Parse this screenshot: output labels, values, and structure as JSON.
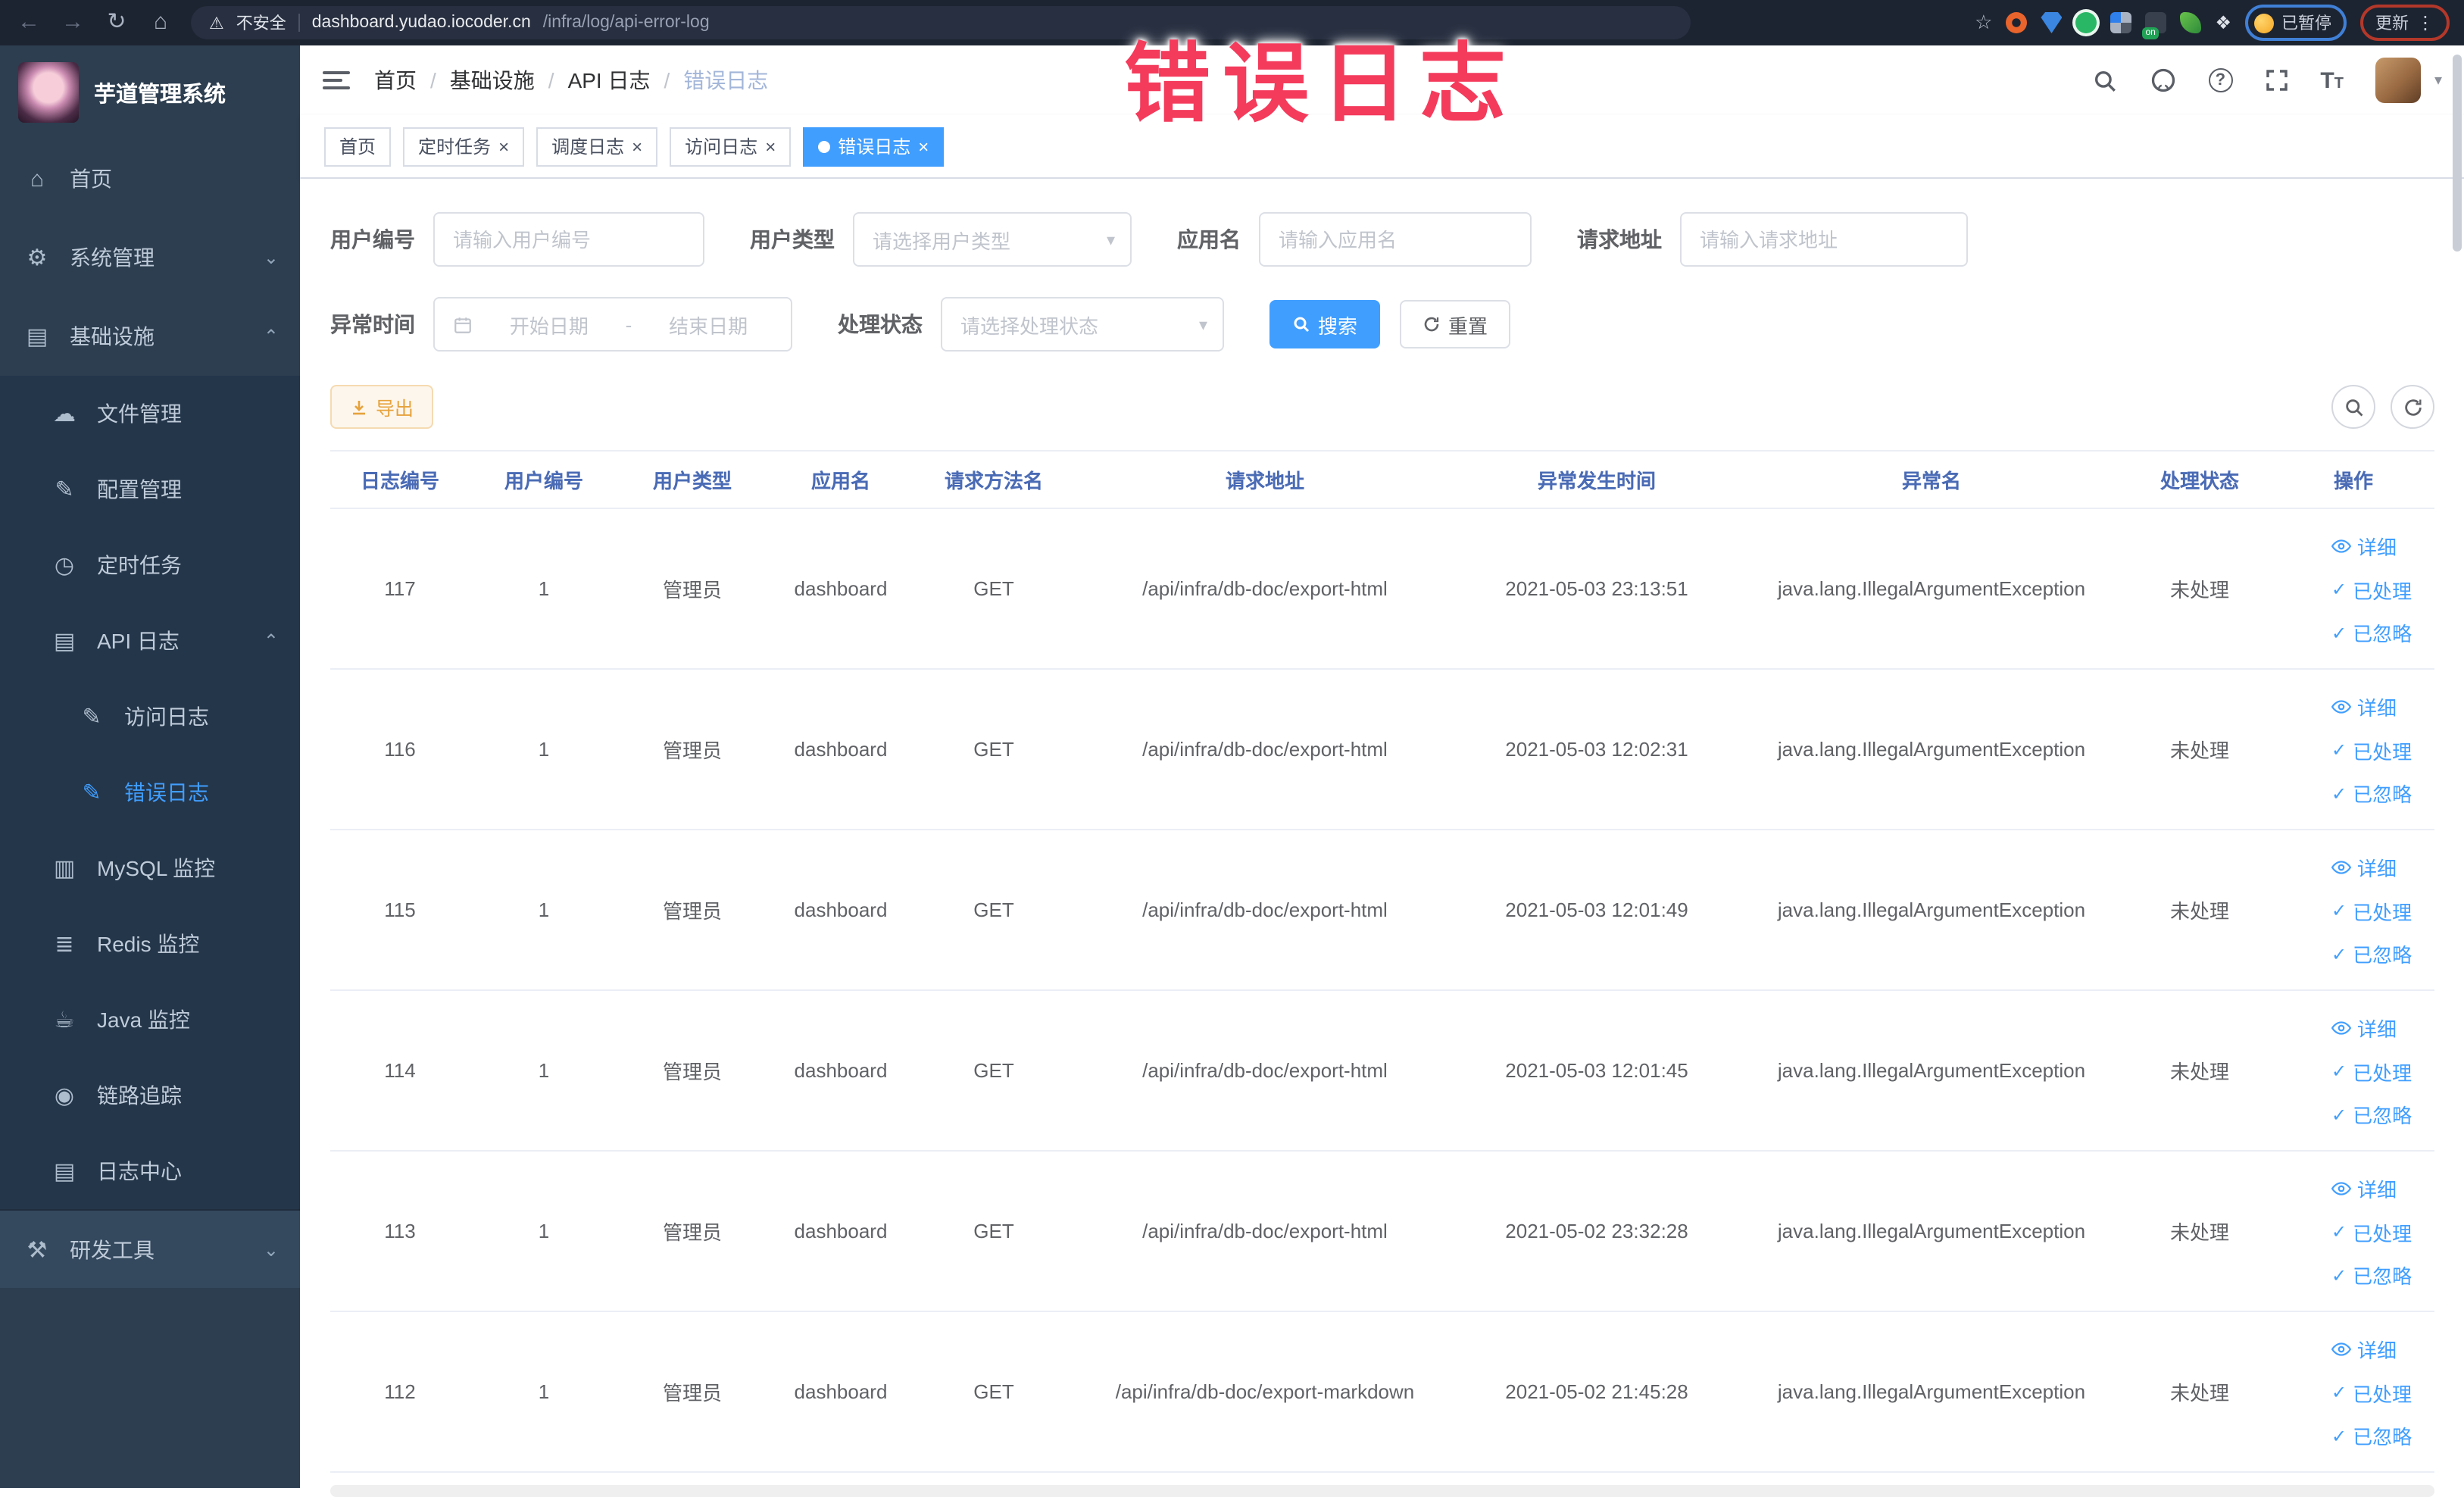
{
  "colors": {
    "accent": "#409eff",
    "sidebar_bg": "#2c3e50",
    "sidebar_submenu_bg": "#24364a",
    "sidebar_highlight_bg": "#34495e",
    "annotation_pink": "#f43b5c",
    "warning_orange": "#e6a23c",
    "table_header_blue": "#4a6bb5",
    "browser_bar_bg": "#1d2431"
  },
  "browser": {
    "security_label": "不安全",
    "url_domain": "dashboard.yudao.iocoder.cn",
    "url_path": "/infra/log/api-error-log",
    "paused_badge": "已暂停",
    "update_label": "更新",
    "ext_on_badge": "on"
  },
  "annotation": {
    "text": "错误日志"
  },
  "sidebar": {
    "logo_title": "芋道管理系统",
    "items": [
      {
        "key": "home",
        "label": "首页",
        "icon": "home",
        "level": 0
      },
      {
        "key": "system",
        "label": "系统管理",
        "icon": "gear",
        "level": 0,
        "chevron": "down"
      },
      {
        "key": "infra",
        "label": "基础设施",
        "icon": "monitor",
        "level": 0,
        "chevron": "up"
      },
      {
        "key": "file",
        "label": "文件管理",
        "icon": "cloud",
        "level": 1,
        "sub": true
      },
      {
        "key": "config",
        "label": "配置管理",
        "icon": "edit",
        "level": 1,
        "sub": true
      },
      {
        "key": "job",
        "label": "定时任务",
        "icon": "clock",
        "level": 1,
        "sub": true
      },
      {
        "key": "api-log",
        "label": "API 日志",
        "icon": "log",
        "level": 1,
        "sub": true,
        "chevron": "up"
      },
      {
        "key": "access-log",
        "label": "访问日志",
        "icon": "edit",
        "level": 2,
        "sub": true
      },
      {
        "key": "error-log",
        "label": "错误日志",
        "icon": "edit",
        "level": 2,
        "sub": true,
        "active": true
      },
      {
        "key": "mysql",
        "label": "MySQL 监控",
        "icon": "chart",
        "level": 1,
        "sub": true
      },
      {
        "key": "redis",
        "label": "Redis 监控",
        "icon": "stack",
        "level": 1,
        "sub": true
      },
      {
        "key": "java",
        "label": "Java 监控",
        "icon": "coffee",
        "level": 1,
        "sub": true
      },
      {
        "key": "trace",
        "label": "链路追踪",
        "icon": "eye",
        "level": 1,
        "sub": true
      },
      {
        "key": "log-center",
        "label": "日志中心",
        "icon": "doc",
        "level": 1,
        "sub": true
      },
      {
        "key": "dev-tools",
        "label": "研发工具",
        "icon": "toolbox",
        "level": 0,
        "chevron": "down",
        "highlight": true
      }
    ]
  },
  "header": {
    "breadcrumb": [
      "首页",
      "基础设施",
      "API 日志",
      "错误日志"
    ]
  },
  "tags": [
    {
      "label": "首页",
      "closable": false,
      "active": false
    },
    {
      "label": "定时任务",
      "closable": true,
      "active": false
    },
    {
      "label": "调度日志",
      "closable": true,
      "active": false
    },
    {
      "label": "访问日志",
      "closable": true,
      "active": false
    },
    {
      "label": "错误日志",
      "closable": true,
      "active": true
    }
  ],
  "filters": {
    "user_id_label": "用户编号",
    "user_id_placeholder": "请输入用户编号",
    "user_type_label": "用户类型",
    "user_type_placeholder": "请选择用户类型",
    "app_name_label": "应用名",
    "app_name_placeholder": "请输入应用名",
    "request_url_label": "请求地址",
    "request_url_placeholder": "请输入请求地址",
    "exception_time_label": "异常时间",
    "start_date_placeholder": "开始日期",
    "range_separator": "-",
    "end_date_placeholder": "结束日期",
    "process_status_label": "处理状态",
    "process_status_placeholder": "请选择处理状态",
    "search_button": "搜索",
    "reset_button": "重置"
  },
  "toolbar": {
    "export_label": "导出"
  },
  "table": {
    "headers": [
      "日志编号",
      "用户编号",
      "用户类型",
      "应用名",
      "请求方法名",
      "请求地址",
      "异常发生时间",
      "异常名",
      "处理状态",
      "操作"
    ],
    "rows": [
      [
        "117",
        "1",
        "管理员",
        "dashboard",
        "GET",
        "/api/infra/db-doc/export-html",
        "2021-05-03 23:13:51",
        "java.lang.IllegalArgumentException",
        "未处理"
      ],
      [
        "116",
        "1",
        "管理员",
        "dashboard",
        "GET",
        "/api/infra/db-doc/export-html",
        "2021-05-03 12:02:31",
        "java.lang.IllegalArgumentException",
        "未处理"
      ],
      [
        "115",
        "1",
        "管理员",
        "dashboard",
        "GET",
        "/api/infra/db-doc/export-html",
        "2021-05-03 12:01:49",
        "java.lang.IllegalArgumentException",
        "未处理"
      ],
      [
        "114",
        "1",
        "管理员",
        "dashboard",
        "GET",
        "/api/infra/db-doc/export-html",
        "2021-05-03 12:01:45",
        "java.lang.IllegalArgumentException",
        "未处理"
      ],
      [
        "113",
        "1",
        "管理员",
        "dashboard",
        "GET",
        "/api/infra/db-doc/export-html",
        "2021-05-02 23:32:28",
        "java.lang.IllegalArgumentException",
        "未处理"
      ],
      [
        "112",
        "1",
        "管理员",
        "dashboard",
        "GET",
        "/api/infra/db-doc/export-markdown",
        "2021-05-02 21:45:28",
        "java.lang.IllegalArgumentException",
        "未处理"
      ]
    ],
    "actions": [
      {
        "label": "详细",
        "icon": "eye"
      },
      {
        "label": "已处理",
        "icon": "check"
      },
      {
        "label": "已忽略",
        "icon": "check"
      }
    ]
  },
  "icons": {
    "home": "⌂",
    "gear": "⚙",
    "monitor": "▤",
    "cloud": "☁",
    "edit": "✎",
    "clock": "◷",
    "log": "▤",
    "chart": "▥",
    "stack": "≣",
    "coffee": "☕",
    "eye": "◉",
    "doc": "▤",
    "toolbox": "⚒",
    "chevron_down": "⌄",
    "chevron_up": "⌃",
    "close": "×",
    "back": "←",
    "forward": "→",
    "reload": "↻",
    "home_nav": "⌂",
    "warning": "⚠",
    "star": "☆",
    "kebab": "⋮",
    "puzzle": "❖",
    "select_arrow": "▾",
    "caret_down": "▾",
    "check": "✓"
  }
}
